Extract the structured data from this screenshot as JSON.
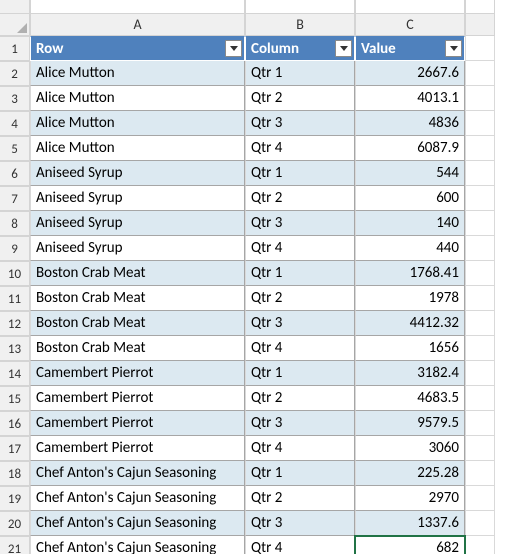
{
  "columns": [
    "A",
    "B",
    "C"
  ],
  "headers": {
    "row": "Row",
    "column": "Column",
    "value": "Value"
  },
  "chart_data": {
    "type": "table",
    "columns": [
      "Row",
      "Column",
      "Value"
    ],
    "rows": [
      [
        "Alice Mutton",
        "Qtr 1",
        2667.6
      ],
      [
        "Alice Mutton",
        "Qtr 2",
        4013.1
      ],
      [
        "Alice Mutton",
        "Qtr 3",
        4836
      ],
      [
        "Alice Mutton",
        "Qtr 4",
        6087.9
      ],
      [
        "Aniseed Syrup",
        "Qtr 1",
        544
      ],
      [
        "Aniseed Syrup",
        "Qtr 2",
        600
      ],
      [
        "Aniseed Syrup",
        "Qtr 3",
        140
      ],
      [
        "Aniseed Syrup",
        "Qtr 4",
        440
      ],
      [
        "Boston Crab Meat",
        "Qtr 1",
        1768.41
      ],
      [
        "Boston Crab Meat",
        "Qtr 2",
        1978
      ],
      [
        "Boston Crab Meat",
        "Qtr 3",
        4412.32
      ],
      [
        "Boston Crab Meat",
        "Qtr 4",
        1656
      ],
      [
        "Camembert Pierrot",
        "Qtr 1",
        3182.4
      ],
      [
        "Camembert Pierrot",
        "Qtr 2",
        4683.5
      ],
      [
        "Camembert Pierrot",
        "Qtr 3",
        9579.5
      ],
      [
        "Camembert Pierrot",
        "Qtr 4",
        3060
      ],
      [
        "Chef Anton's Cajun Seasoning",
        "Qtr 1",
        225.28
      ],
      [
        "Chef Anton's Cajun Seasoning",
        "Qtr 2",
        2970
      ],
      [
        "Chef Anton's Cajun Seasoning",
        "Qtr 3",
        1337.6
      ],
      [
        "Chef Anton's Cajun Seasoning",
        "Qtr 4",
        682
      ]
    ]
  }
}
